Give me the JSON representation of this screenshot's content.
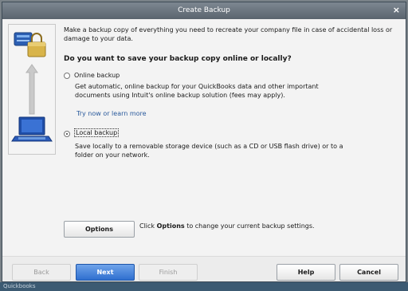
{
  "dialog": {
    "title": "Create Backup",
    "close_symbol": "×",
    "intro": "Make a backup copy of everything you need to recreate your company file in case of accidental loss or damage to your data.",
    "question": "Do you want to save your backup copy online or locally?"
  },
  "options": {
    "online": {
      "label": "Online backup",
      "selected": false,
      "description": "Get automatic, online backup for your QuickBooks data and other important documents using Intuit's online backup solution (fees may apply).",
      "link": "Try now or learn more"
    },
    "local": {
      "label": "Local backup",
      "selected": true,
      "description": "Save locally to a removable storage device (such as a CD or USB flash drive) or to a folder on your network."
    }
  },
  "settings": {
    "options_button": "Options",
    "hint_prefix": "Click ",
    "hint_bold": "Options",
    "hint_suffix": " to change your current backup settings."
  },
  "footer": {
    "back": "Back",
    "next": "Next",
    "finish": "Finish",
    "help": "Help",
    "cancel": "Cancel"
  },
  "background": {
    "partial_text": "Quickbooks"
  },
  "icons": {
    "computer": "laptop-icon",
    "lock": "padlock-icon",
    "arrow": "arrow-up-icon"
  },
  "colors": {
    "titlebar": "#6b757f",
    "primary_button": "#2f6fcf",
    "link": "#2a5a9c"
  }
}
